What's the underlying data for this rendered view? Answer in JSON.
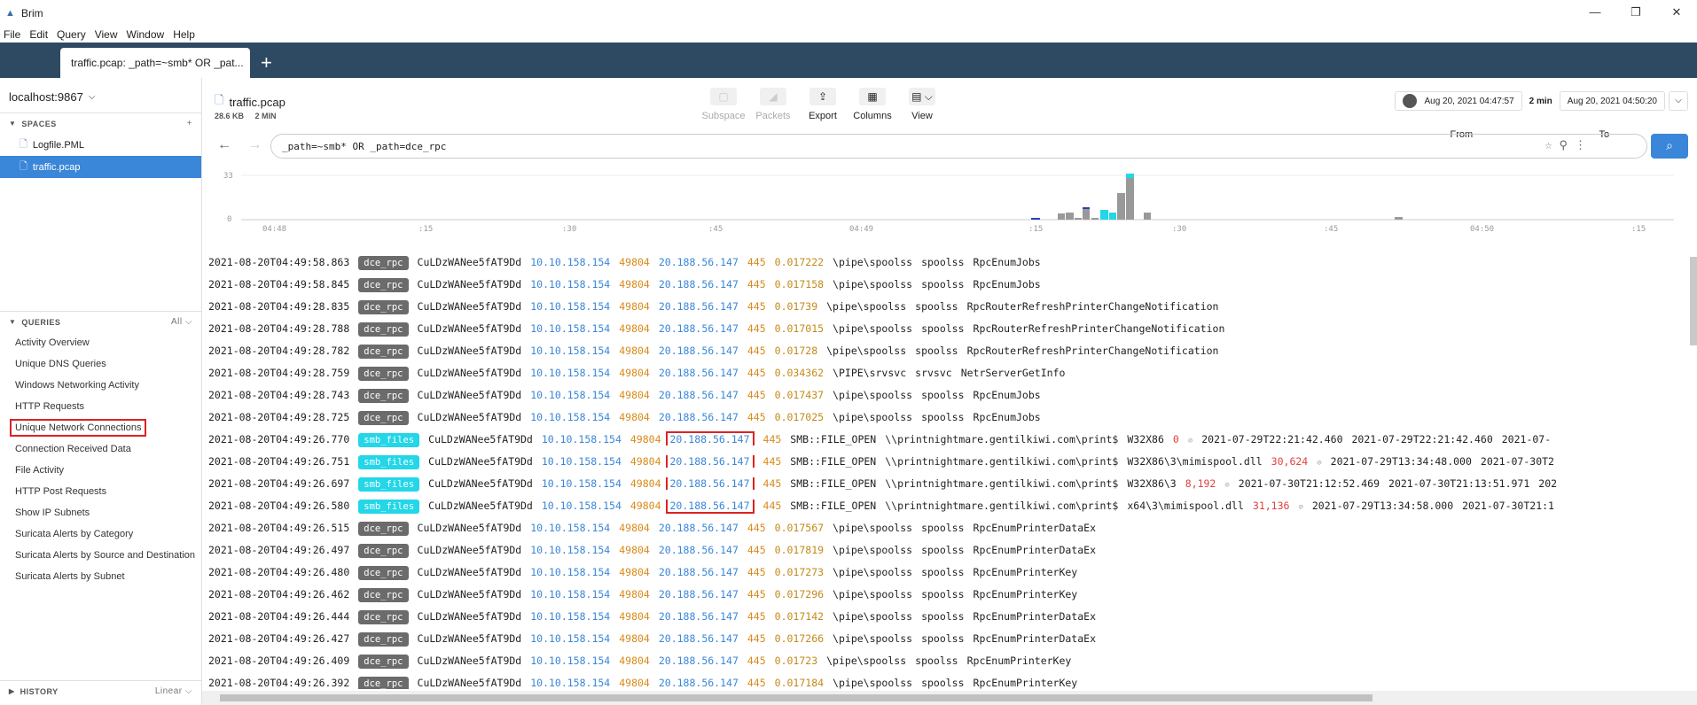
{
  "window": {
    "title": "Brim",
    "controls": [
      "—",
      "❐",
      "✕"
    ]
  },
  "menu": [
    "File",
    "Edit",
    "Query",
    "View",
    "Window",
    "Help"
  ],
  "tabs": [
    {
      "label": "traffic.pcap: _path=~smb* OR _pat..."
    }
  ],
  "sidebar": {
    "host": "localhost:9867",
    "spaces_label": "SPACES",
    "spaces": [
      {
        "name": "Logfile.PML",
        "active": false
      },
      {
        "name": "traffic.pcap",
        "active": true
      }
    ],
    "queries_label": "QUERIES",
    "queries_filter": "All",
    "queries": [
      "Activity Overview",
      "Unique DNS Queries",
      "Windows Networking Activity",
      "HTTP Requests",
      "Unique Network Connections",
      "Connection Received Data",
      "File Activity",
      "HTTP Post Requests",
      "Show IP Subnets",
      "Suricata Alerts by Category",
      "Suricata Alerts by Source and Destination",
      "Suricata Alerts by Subnet"
    ],
    "history_label": "HISTORY",
    "history_mode": "Linear"
  },
  "header": {
    "file": "traffic.pcap",
    "size": "28.6 KB",
    "duration": "2 MIN",
    "tools": [
      {
        "label": "Subspace",
        "icon": "subspace-icon",
        "enabled": false
      },
      {
        "label": "Packets",
        "icon": "packets-icon",
        "enabled": false
      },
      {
        "label": "Export",
        "icon": "export-icon",
        "enabled": true
      },
      {
        "label": "Columns",
        "icon": "columns-icon",
        "enabled": true
      },
      {
        "label": "View",
        "icon": "view-icon",
        "enabled": true
      }
    ],
    "from_time": "Aug 20, 2021  04:47:57",
    "span": "2 min",
    "to_time": "Aug 20, 2021  04:50:20",
    "from_label": "From",
    "to_label": "To"
  },
  "search": {
    "query": "_path=~smb* OR _path=dce_rpc"
  },
  "histogram": {
    "y_ticks": [
      "33",
      "0"
    ],
    "x_ticks": [
      "04:48",
      ":15",
      ":30",
      ":45",
      "04:49",
      ":15",
      ":30",
      ":45",
      "04:50",
      ":15"
    ]
  },
  "events": [
    {
      "ts": "2021-08-20T04:49:58.863",
      "path": "dce_rpc",
      "uid": "CuLDzWANee5fAT9Dd",
      "src": "10.10.158.154",
      "sport": "49804",
      "dst": "20.188.56.147",
      "dport": "445",
      "rest": [
        "0.017222",
        "\\pipe\\spoolss",
        "spoolss",
        "RpcEnumJobs"
      ]
    },
    {
      "ts": "2021-08-20T04:49:58.845",
      "path": "dce_rpc",
      "uid": "CuLDzWANee5fAT9Dd",
      "src": "10.10.158.154",
      "sport": "49804",
      "dst": "20.188.56.147",
      "dport": "445",
      "rest": [
        "0.017158",
        "\\pipe\\spoolss",
        "spoolss",
        "RpcEnumJobs"
      ]
    },
    {
      "ts": "2021-08-20T04:49:28.835",
      "path": "dce_rpc",
      "uid": "CuLDzWANee5fAT9Dd",
      "src": "10.10.158.154",
      "sport": "49804",
      "dst": "20.188.56.147",
      "dport": "445",
      "rest": [
        "0.01739",
        "\\pipe\\spoolss",
        "spoolss",
        "RpcRouterRefreshPrinterChangeNotification"
      ]
    },
    {
      "ts": "2021-08-20T04:49:28.788",
      "path": "dce_rpc",
      "uid": "CuLDzWANee5fAT9Dd",
      "src": "10.10.158.154",
      "sport": "49804",
      "dst": "20.188.56.147",
      "dport": "445",
      "rest": [
        "0.017015",
        "\\pipe\\spoolss",
        "spoolss",
        "RpcRouterRefreshPrinterChangeNotification"
      ]
    },
    {
      "ts": "2021-08-20T04:49:28.782",
      "path": "dce_rpc",
      "uid": "CuLDzWANee5fAT9Dd",
      "src": "10.10.158.154",
      "sport": "49804",
      "dst": "20.188.56.147",
      "dport": "445",
      "rest": [
        "0.01728",
        "\\pipe\\spoolss",
        "spoolss",
        "RpcRouterRefreshPrinterChangeNotification"
      ]
    },
    {
      "ts": "2021-08-20T04:49:28.759",
      "path": "dce_rpc",
      "uid": "CuLDzWANee5fAT9Dd",
      "src": "10.10.158.154",
      "sport": "49804",
      "dst": "20.188.56.147",
      "dport": "445",
      "rest": [
        "0.034362",
        "\\PIPE\\srvsvc",
        "srvsvc",
        "NetrServerGetInfo"
      ]
    },
    {
      "ts": "2021-08-20T04:49:28.743",
      "path": "dce_rpc",
      "uid": "CuLDzWANee5fAT9Dd",
      "src": "10.10.158.154",
      "sport": "49804",
      "dst": "20.188.56.147",
      "dport": "445",
      "rest": [
        "0.017437",
        "\\pipe\\spoolss",
        "spoolss",
        "RpcEnumJobs"
      ]
    },
    {
      "ts": "2021-08-20T04:49:28.725",
      "path": "dce_rpc",
      "uid": "CuLDzWANee5fAT9Dd",
      "src": "10.10.158.154",
      "sport": "49804",
      "dst": "20.188.56.147",
      "dport": "445",
      "rest": [
        "0.017025",
        "\\pipe\\spoolss",
        "spoolss",
        "RpcEnumJobs"
      ]
    },
    {
      "ts": "2021-08-20T04:49:26.770",
      "path": "smb_files",
      "uid": "CuLDzWANee5fAT9Dd",
      "src": "10.10.158.154",
      "sport": "49804",
      "dst": "20.188.56.147",
      "dport": "445",
      "action": "SMB::FILE_OPEN",
      "share": "\\\\printnightmare.gentilkiwi.com\\print$",
      "name": "W32X86",
      "size": "0",
      "t1": "2021-07-29T22:21:42.460",
      "t2": "2021-07-29T22:21:42.460",
      "t3": "2021-07-"
    },
    {
      "ts": "2021-08-20T04:49:26.751",
      "path": "smb_files",
      "uid": "CuLDzWANee5fAT9Dd",
      "src": "10.10.158.154",
      "sport": "49804",
      "dst": "20.188.56.147",
      "dport": "445",
      "action": "SMB::FILE_OPEN",
      "share": "\\\\printnightmare.gentilkiwi.com\\print$",
      "name": "W32X86\\3\\mimispool.dll",
      "size": "30,624",
      "t1": "2021-07-29T13:34:48.000",
      "t2": "2021-07-30T2",
      "t3": ""
    },
    {
      "ts": "2021-08-20T04:49:26.697",
      "path": "smb_files",
      "uid": "CuLDzWANee5fAT9Dd",
      "src": "10.10.158.154",
      "sport": "49804",
      "dst": "20.188.56.147",
      "dport": "445",
      "action": "SMB::FILE_OPEN",
      "share": "\\\\printnightmare.gentilkiwi.com\\print$",
      "name": "W32X86\\3",
      "size": "8,192",
      "t1": "2021-07-30T21:12:52.469",
      "t2": "2021-07-30T21:13:51.971",
      "t3": "202"
    },
    {
      "ts": "2021-08-20T04:49:26.580",
      "path": "smb_files",
      "uid": "CuLDzWANee5fAT9Dd",
      "src": "10.10.158.154",
      "sport": "49804",
      "dst": "20.188.56.147",
      "dport": "445",
      "action": "SMB::FILE_OPEN",
      "share": "\\\\printnightmare.gentilkiwi.com\\print$",
      "name": "x64\\3\\mimispool.dll",
      "size": "31,136",
      "t1": "2021-07-29T13:34:58.000",
      "t2": "2021-07-30T21:1",
      "t3": ""
    },
    {
      "ts": "2021-08-20T04:49:26.515",
      "path": "dce_rpc",
      "uid": "CuLDzWANee5fAT9Dd",
      "src": "10.10.158.154",
      "sport": "49804",
      "dst": "20.188.56.147",
      "dport": "445",
      "rest": [
        "0.017567",
        "\\pipe\\spoolss",
        "spoolss",
        "RpcEnumPrinterDataEx"
      ]
    },
    {
      "ts": "2021-08-20T04:49:26.497",
      "path": "dce_rpc",
      "uid": "CuLDzWANee5fAT9Dd",
      "src": "10.10.158.154",
      "sport": "49804",
      "dst": "20.188.56.147",
      "dport": "445",
      "rest": [
        "0.017819",
        "\\pipe\\spoolss",
        "spoolss",
        "RpcEnumPrinterDataEx"
      ]
    },
    {
      "ts": "2021-08-20T04:49:26.480",
      "path": "dce_rpc",
      "uid": "CuLDzWANee5fAT9Dd",
      "src": "10.10.158.154",
      "sport": "49804",
      "dst": "20.188.56.147",
      "dport": "445",
      "rest": [
        "0.017273",
        "\\pipe\\spoolss",
        "spoolss",
        "RpcEnumPrinterKey"
      ]
    },
    {
      "ts": "2021-08-20T04:49:26.462",
      "path": "dce_rpc",
      "uid": "CuLDzWANee5fAT9Dd",
      "src": "10.10.158.154",
      "sport": "49804",
      "dst": "20.188.56.147",
      "dport": "445",
      "rest": [
        "0.017296",
        "\\pipe\\spoolss",
        "spoolss",
        "RpcEnumPrinterKey"
      ]
    },
    {
      "ts": "2021-08-20T04:49:26.444",
      "path": "dce_rpc",
      "uid": "CuLDzWANee5fAT9Dd",
      "src": "10.10.158.154",
      "sport": "49804",
      "dst": "20.188.56.147",
      "dport": "445",
      "rest": [
        "0.017142",
        "\\pipe\\spoolss",
        "spoolss",
        "RpcEnumPrinterDataEx"
      ]
    },
    {
      "ts": "2021-08-20T04:49:26.427",
      "path": "dce_rpc",
      "uid": "CuLDzWANee5fAT9Dd",
      "src": "10.10.158.154",
      "sport": "49804",
      "dst": "20.188.56.147",
      "dport": "445",
      "rest": [
        "0.017266",
        "\\pipe\\spoolss",
        "spoolss",
        "RpcEnumPrinterDataEx"
      ]
    },
    {
      "ts": "2021-08-20T04:49:26.409",
      "path": "dce_rpc",
      "uid": "CuLDzWANee5fAT9Dd",
      "src": "10.10.158.154",
      "sport": "49804",
      "dst": "20.188.56.147",
      "dport": "445",
      "rest": [
        "0.01723",
        "\\pipe\\spoolss",
        "spoolss",
        "RpcEnumPrinterKey"
      ]
    },
    {
      "ts": "2021-08-20T04:49:26.392",
      "path": "dce_rpc",
      "uid": "CuLDzWANee5fAT9Dd",
      "src": "10.10.158.154",
      "sport": "49804",
      "dst": "20.188.56.147",
      "dport": "445",
      "rest": [
        "0.017184",
        "\\pipe\\spoolss",
        "spoolss",
        "RpcEnumPrinterKey"
      ]
    }
  ]
}
